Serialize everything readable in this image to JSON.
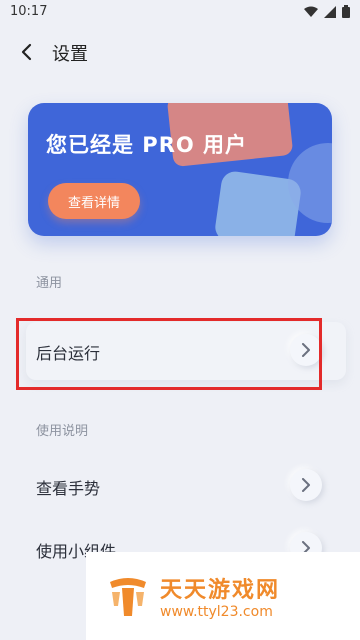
{
  "status_bar": {
    "time": "10:17"
  },
  "app_bar": {
    "title": "设置"
  },
  "pro_card": {
    "title": "您已经是 PRO 用户",
    "button": "查看详情"
  },
  "sections": [
    {
      "label": "通用",
      "items": [
        {
          "label": "后台运行"
        }
      ]
    },
    {
      "label": "使用说明",
      "items": [
        {
          "label": "查看手势"
        },
        {
          "label": "使用小组件"
        }
      ]
    }
  ],
  "watermark": {
    "name": "天天游戏网",
    "url": "www.ttyl23.com"
  },
  "colors": {
    "accent": "#3f66d9",
    "button": "#f3865d",
    "highlight": "#e32a2a",
    "watermark": "#f08a2b"
  },
  "icons": {
    "back": "back-arrow-icon",
    "chevron": "chevron-right-icon",
    "wifi": "wifi-icon",
    "signal": "signal-icon",
    "battery": "battery-icon"
  }
}
